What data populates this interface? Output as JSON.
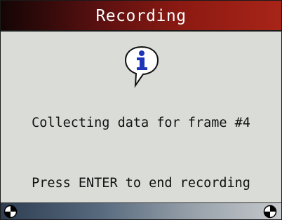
{
  "header": {
    "title": "Recording"
  },
  "dialog": {
    "icon": "info-icon",
    "message_line1": "Collecting data for frame #4",
    "message_line2": "Press ENTER to end recording"
  },
  "footer": {
    "left_icon": "softkey-left-icon",
    "right_icon": "softkey-right-icon"
  },
  "colors": {
    "title_bar_start": "#140505",
    "title_bar_end": "#a82418",
    "background": "#d9dcd7",
    "text": "#111111",
    "footer_start": "#2e3d52",
    "footer_end": "#c6c9cc",
    "icon_blue": "#1f35b8"
  }
}
